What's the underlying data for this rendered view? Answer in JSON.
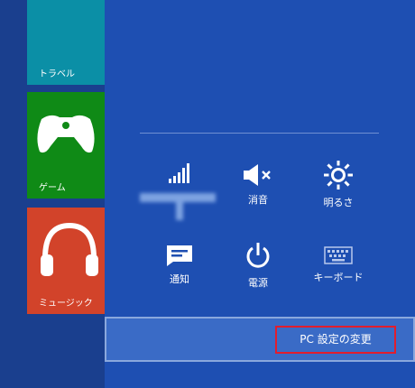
{
  "tiles": {
    "travel": "トラベル",
    "games": "ゲーム",
    "music": "ミュージック"
  },
  "settings": {
    "network": "",
    "volume": "消音",
    "brightness": "明るさ",
    "notifications": "通知",
    "power": "電源",
    "keyboard": "キーボード"
  },
  "change_pc_settings": "PC 設定の変更",
  "colors": {
    "charm_bg": "#1e4fb2",
    "travel_tile": "#0b8fa6",
    "games_tile": "#0f8a16",
    "music_tile": "#d2432a",
    "highlight_border": "#e21d2d"
  },
  "icons": [
    "signal-bars-icon",
    "speaker-muted-icon",
    "sun-icon",
    "notification-icon",
    "power-icon",
    "keyboard-icon",
    "gamepad-icon",
    "headphones-icon"
  ]
}
